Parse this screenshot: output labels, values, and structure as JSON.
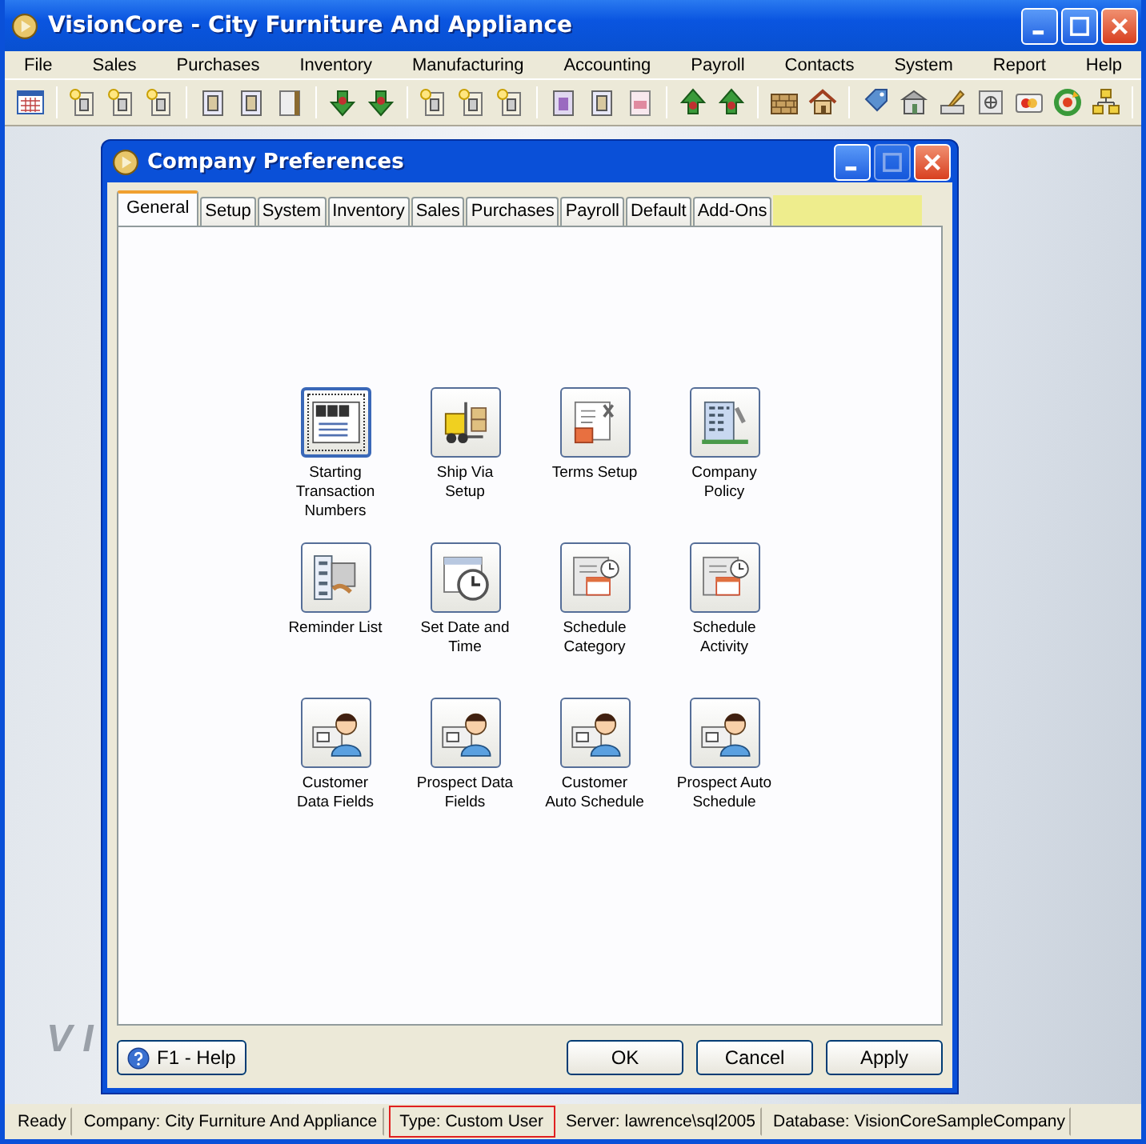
{
  "window": {
    "title": "VisionCore - City Furniture And Appliance"
  },
  "menu": [
    "File",
    "Sales",
    "Purchases",
    "Inventory",
    "Manufacturing",
    "Accounting",
    "Payroll",
    "Contacts",
    "System",
    "Report",
    "Help"
  ],
  "background_mark": "V I",
  "dialog": {
    "title": "Company Preferences",
    "tabs": [
      {
        "label": "General",
        "selected": true
      },
      {
        "label": "Setup",
        "selected": false
      },
      {
        "label": "System",
        "selected": false
      },
      {
        "label": "Inventory",
        "selected": false
      },
      {
        "label": "Sales",
        "selected": false
      },
      {
        "label": "Purchases",
        "selected": false
      },
      {
        "label": "Payroll",
        "selected": false
      },
      {
        "label": "Default",
        "selected": false
      },
      {
        "label": "Add-Ons",
        "selected": false
      }
    ],
    "tab_strip_highlighted": true,
    "items": [
      {
        "label": "Starting Transaction Numbers",
        "kind": "counter",
        "selected": true
      },
      {
        "label": "Ship Via Setup",
        "kind": "forklift",
        "selected": false
      },
      {
        "label": "Terms Setup",
        "kind": "terms",
        "selected": false
      },
      {
        "label": "Company Policy",
        "kind": "building",
        "selected": false
      },
      {
        "label": "Reminder List",
        "kind": "list",
        "selected": false
      },
      {
        "label": "Set Date and Time",
        "kind": "clock",
        "selected": false
      },
      {
        "label": "Schedule Category",
        "kind": "schedule",
        "selected": false
      },
      {
        "label": "Schedule Activity",
        "kind": "schedule",
        "selected": false
      },
      {
        "label": "Customer Data Fields",
        "kind": "person",
        "selected": false
      },
      {
        "label": "Prospect Data Fields",
        "kind": "person",
        "selected": false
      },
      {
        "label": "Customer Auto Schedule",
        "kind": "person",
        "selected": false
      },
      {
        "label": "Prospect Auto Schedule",
        "kind": "person",
        "selected": false
      }
    ],
    "help_button": "F1 - Help",
    "buttons": [
      "OK",
      "Cancel",
      "Apply"
    ]
  },
  "status_bar": [
    {
      "text": "Ready",
      "outlined": false
    },
    {
      "text": "Company: City Furniture And Appliance",
      "outlined": false
    },
    {
      "text": "Type: Custom User",
      "outlined": true
    },
    {
      "text": "Server: lawrence\\sql2005",
      "outlined": false
    },
    {
      "text": "Database: VisionCoreSampleCompany",
      "outlined": false
    }
  ]
}
